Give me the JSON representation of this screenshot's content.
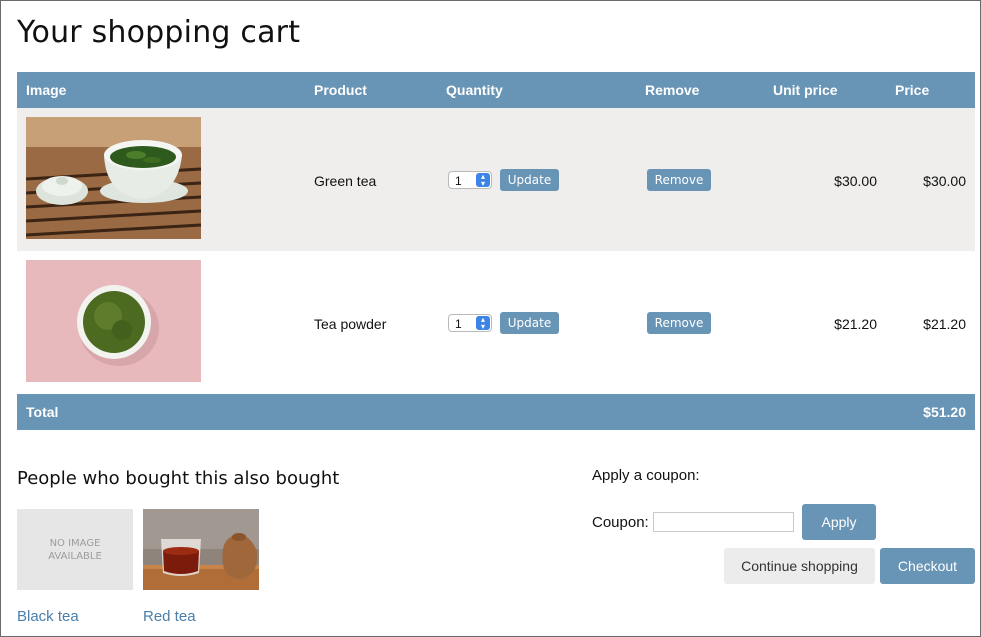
{
  "page": {
    "title": "Your shopping cart"
  },
  "cart": {
    "columns": {
      "image": "Image",
      "product": "Product",
      "quantity": "Quantity",
      "remove": "Remove",
      "unit_price": "Unit price",
      "price": "Price"
    },
    "items": [
      {
        "product": "Green tea",
        "quantity": "1",
        "update_label": "Update",
        "remove_label": "Remove",
        "unit_price": "$30.00",
        "price": "$30.00"
      },
      {
        "product": "Tea powder",
        "quantity": "1",
        "update_label": "Update",
        "remove_label": "Remove",
        "unit_price": "$21.20",
        "price": "$21.20"
      }
    ],
    "total_label": "Total",
    "total_value": "$51.20"
  },
  "recommendations": {
    "title": "People who bought this also bought",
    "no_image_line1": "NO IMAGE",
    "no_image_line2": "AVAILABLE",
    "items": [
      {
        "name": "Black tea"
      },
      {
        "name": "Red tea"
      }
    ]
  },
  "coupon": {
    "heading": "Apply a coupon:",
    "label": "Coupon:",
    "value": "",
    "apply_label": "Apply"
  },
  "actions": {
    "continue_label": "Continue shopping",
    "checkout_label": "Checkout"
  },
  "colors": {
    "accent": "#6894b6",
    "row_shade": "#efeeed",
    "link": "#4a7ea8"
  }
}
